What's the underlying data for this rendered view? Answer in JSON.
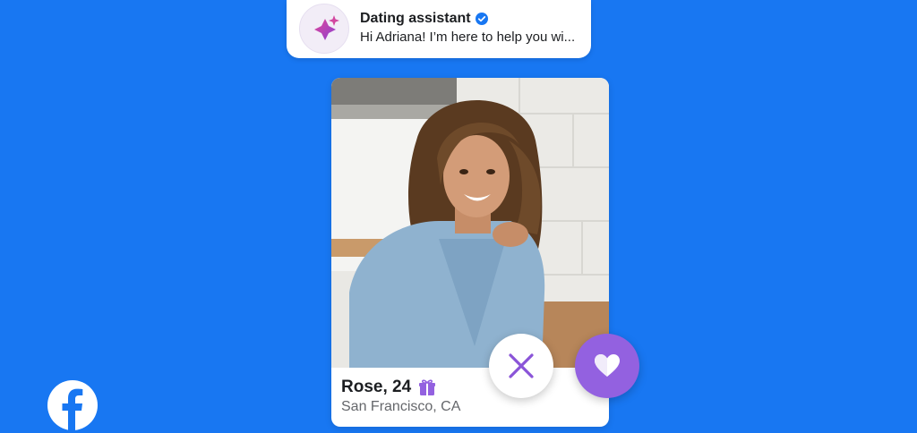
{
  "notification": {
    "title": "Dating assistant",
    "message": "Hi Adriana! I’m here to help you wi...",
    "verified": true,
    "avatar_icon": "sparkle-icon"
  },
  "profile": {
    "name_age": "Rose, 24",
    "location": "San Francisco, CA",
    "badge_icon": "gift-icon"
  },
  "actions": {
    "pass_icon": "close-icon",
    "like_icon": "heart-icon"
  },
  "colors": {
    "background": "#1877f2",
    "accent_purple": "#9361e0",
    "verified_blue": "#1877f2"
  },
  "brand": {
    "logo_icon": "facebook-logo-icon"
  }
}
